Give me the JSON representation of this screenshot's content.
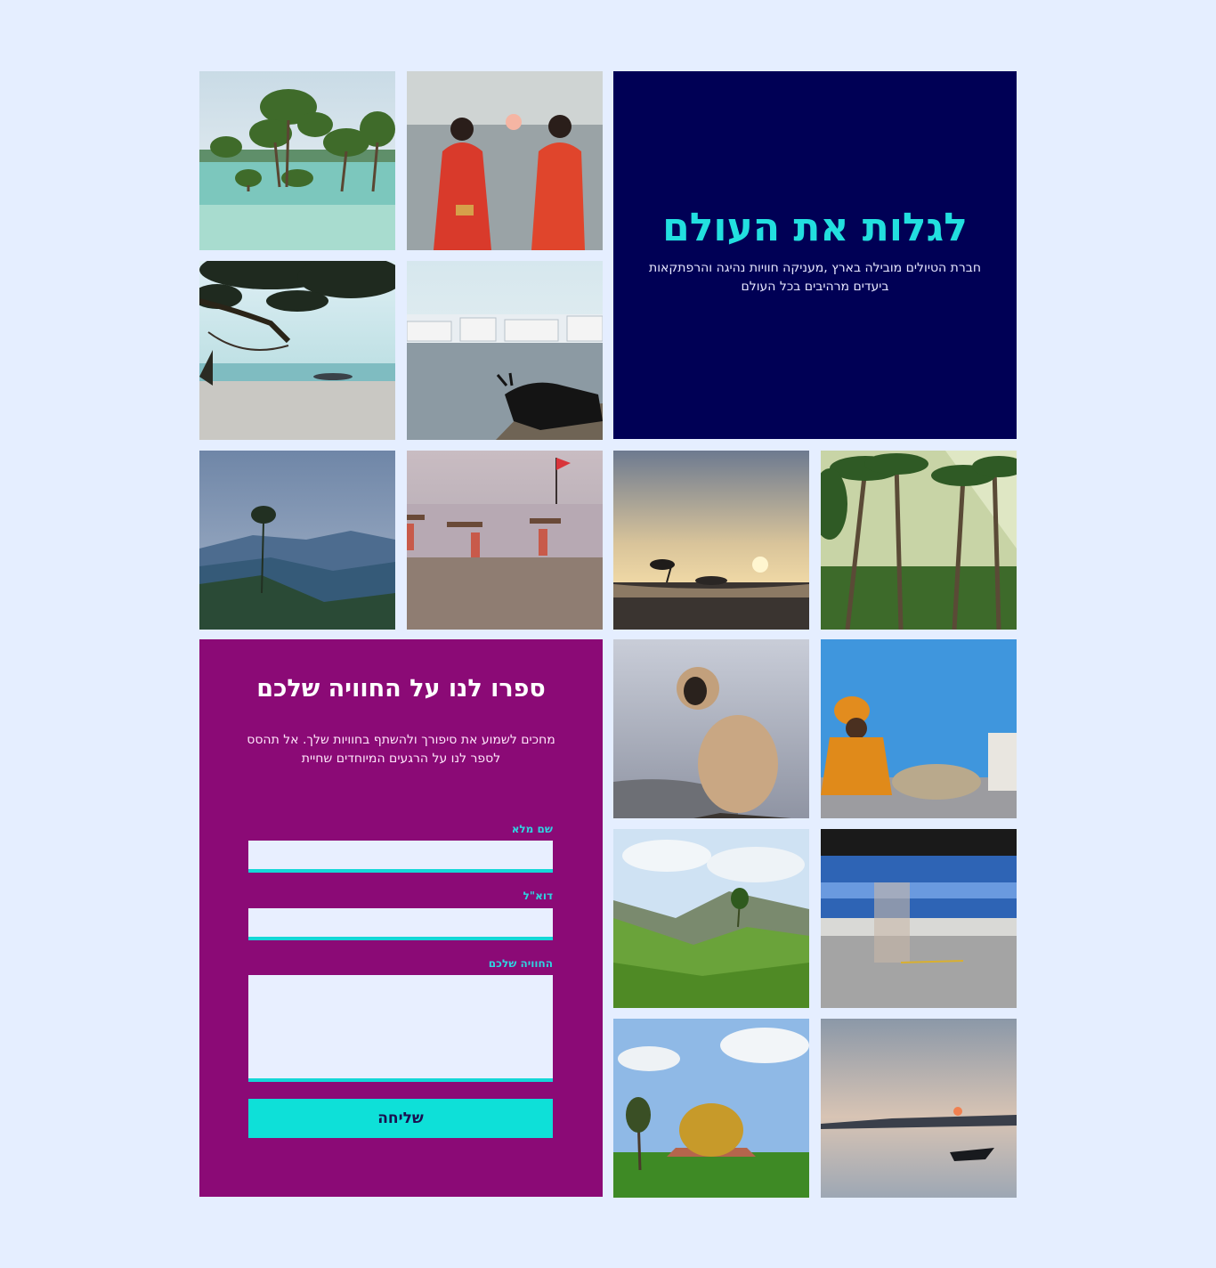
{
  "hero": {
    "title": "לגלות את העולם",
    "subtitle": "חברת הטיולים מובילה בארץ ,מעניקה חוויות נהיגה והרפתקאות ביעדים מרהיבים בכל העולם"
  },
  "form": {
    "title": "ספרו לנו על החוויה שלכם",
    "intro": "מחכים לשמוע את סיפורך ולהשתף בחוויות שלך. אל תהסס לספר לנו על הרגעים המיוחדים שחיית",
    "name_label": "שם מלא",
    "email_label": "דוא\"ל",
    "experience_label": "החוויה שלכם",
    "submit_label": "שליחה"
  },
  "photos": [
    {
      "id": "mangrove-trees-photo"
    },
    {
      "id": "women-sunset-photo"
    },
    {
      "id": "beach-hammock-photo"
    },
    {
      "id": "lake-cow-photo"
    },
    {
      "id": "misty-hills-photo"
    },
    {
      "id": "beach-porters-photo"
    },
    {
      "id": "sunset-shore-photo"
    },
    {
      "id": "palm-forest-photo"
    },
    {
      "id": "monkey-photo"
    },
    {
      "id": "sadhu-photo"
    },
    {
      "id": "tea-plantation-photo"
    },
    {
      "id": "blue-train-photo"
    },
    {
      "id": "golden-dome-photo"
    },
    {
      "id": "boat-sunset-photo"
    }
  ],
  "colors": {
    "background": "#e5eeff",
    "hero_bg": "#000055",
    "hero_title": "#22dfdf",
    "form_bg": "#8b0a76",
    "accent": "#0ee0d8"
  }
}
